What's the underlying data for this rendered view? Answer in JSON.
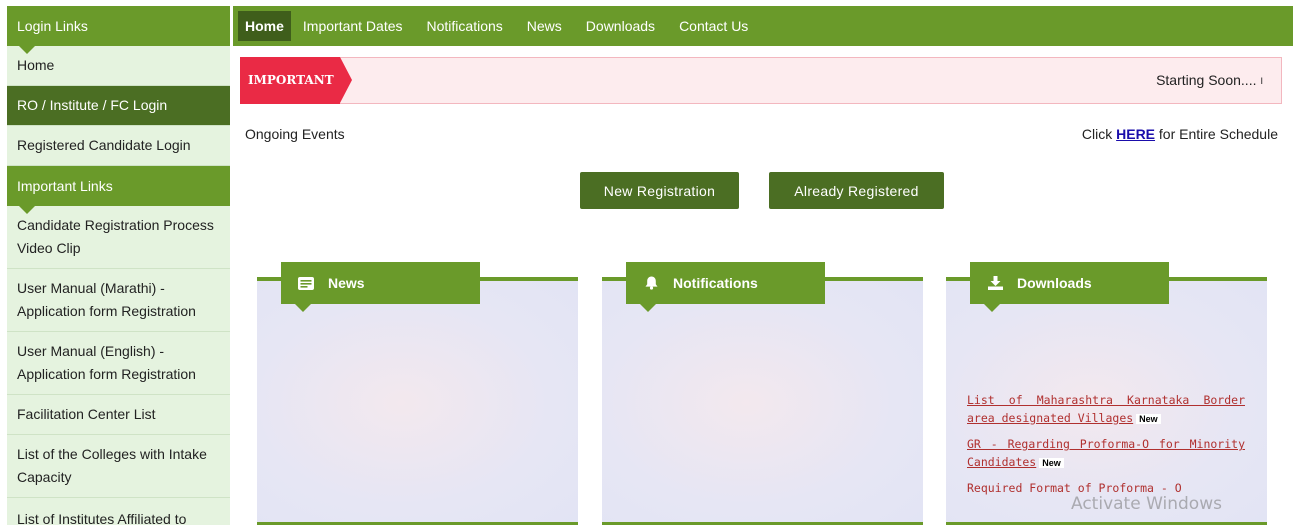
{
  "sidebar": {
    "login_header": "Login Links",
    "login_items": [
      {
        "label": "Home"
      },
      {
        "label": "RO / Institute / FC Login"
      },
      {
        "label": "Registered Candidate Login"
      }
    ],
    "important_header": "Important Links",
    "important_items": [
      {
        "label": "Candidate Registration Process Video Clip"
      },
      {
        "label": "User Manual (Marathi) - Application form Registration"
      },
      {
        "label": "User Manual (English) - Application form Registration"
      },
      {
        "label": "Facilitation Center List"
      },
      {
        "label": "List of the Colleges with Intake Capacity"
      },
      {
        "label": "List of Institutes Affiliated to"
      }
    ]
  },
  "nav": {
    "items": [
      "Home",
      "Important Dates",
      "Notifications",
      "News",
      "Downloads",
      "Contact Us"
    ],
    "active": "Home"
  },
  "ticker": {
    "badge": "IMPORTANT",
    "text": "Starting Soon....",
    "bar": "I"
  },
  "ongoing": {
    "label": "Ongoing Events",
    "schedule_prefix": "Click",
    "schedule_link": "HERE",
    "schedule_suffix": "for Entire Schedule"
  },
  "buttons": {
    "new_registration": "New Registration",
    "already_registered": "Already Registered"
  },
  "panels": {
    "news": {
      "title": "News",
      "icon": "newspaper-icon"
    },
    "notifications": {
      "title": "Notifications",
      "icon": "bell-icon"
    },
    "downloads": {
      "title": "Downloads",
      "icon": "download-icon",
      "items": [
        {
          "text": "List of Maharashtra Karnataka Border area designated Villages",
          "badge": "New"
        },
        {
          "text": "GR - Regarding Proforma-O for Minority Candidates",
          "badge": "New"
        },
        {
          "text": "Required Format of Proforma - O",
          "badge": ""
        }
      ]
    }
  },
  "watermark": "Activate Windows",
  "colors": {
    "primary": "#6a9a2a",
    "dark": "#4b6e23",
    "important": "#ea2a45"
  }
}
